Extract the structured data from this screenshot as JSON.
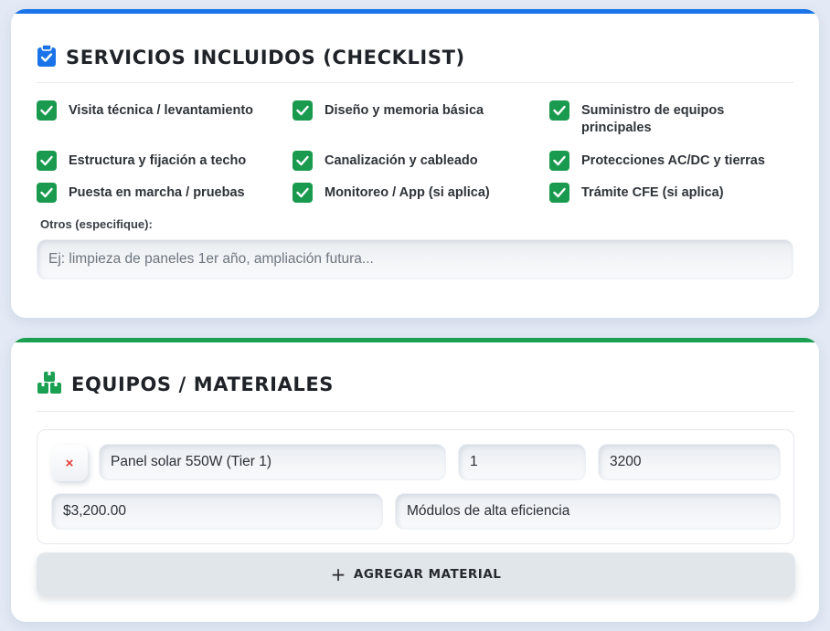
{
  "services": {
    "title": "SERVICIOS INCLUIDOS (CHECKLIST)",
    "icon": "clipboard-check-icon",
    "accent": "#1a73e8",
    "items": [
      {
        "label": "Visita técnica / levantamiento",
        "checked": true
      },
      {
        "label": "Diseño y memoria básica",
        "checked": true
      },
      {
        "label": "Suministro de equipos principales",
        "checked": true
      },
      {
        "label": "Estructura y fijación a techo",
        "checked": true
      },
      {
        "label": "Canalización y cableado",
        "checked": true
      },
      {
        "label": "Protecciones AC/DC y tierras",
        "checked": true
      },
      {
        "label": "Puesta en marcha / pruebas",
        "checked": true
      },
      {
        "label": "Monitoreo / App (si aplica)",
        "checked": true
      },
      {
        "label": "Trámite CFE (si aplica)",
        "checked": true
      }
    ],
    "others_label": "Otros (especifique):",
    "others_placeholder": "Ej: limpieza de paneles 1er año, ampliación futura..."
  },
  "materials": {
    "title": "EQUIPOS / MATERIALES",
    "icon": "boxes-icon",
    "accent": "#1ba052",
    "rows": [
      {
        "remove_label": "×",
        "description": "Panel solar 550W (Tier 1)",
        "quantity": "1",
        "unit_price": "3200",
        "total": "$3,200.00",
        "notes": "Módulos de alta eficiencia"
      }
    ],
    "add_plus": "+",
    "add_label": "AGREGAR MATERIAL"
  },
  "colors": {
    "checkbox": "#1a9a4e",
    "background": "#e3eaf5",
    "remove": "#e53935"
  }
}
